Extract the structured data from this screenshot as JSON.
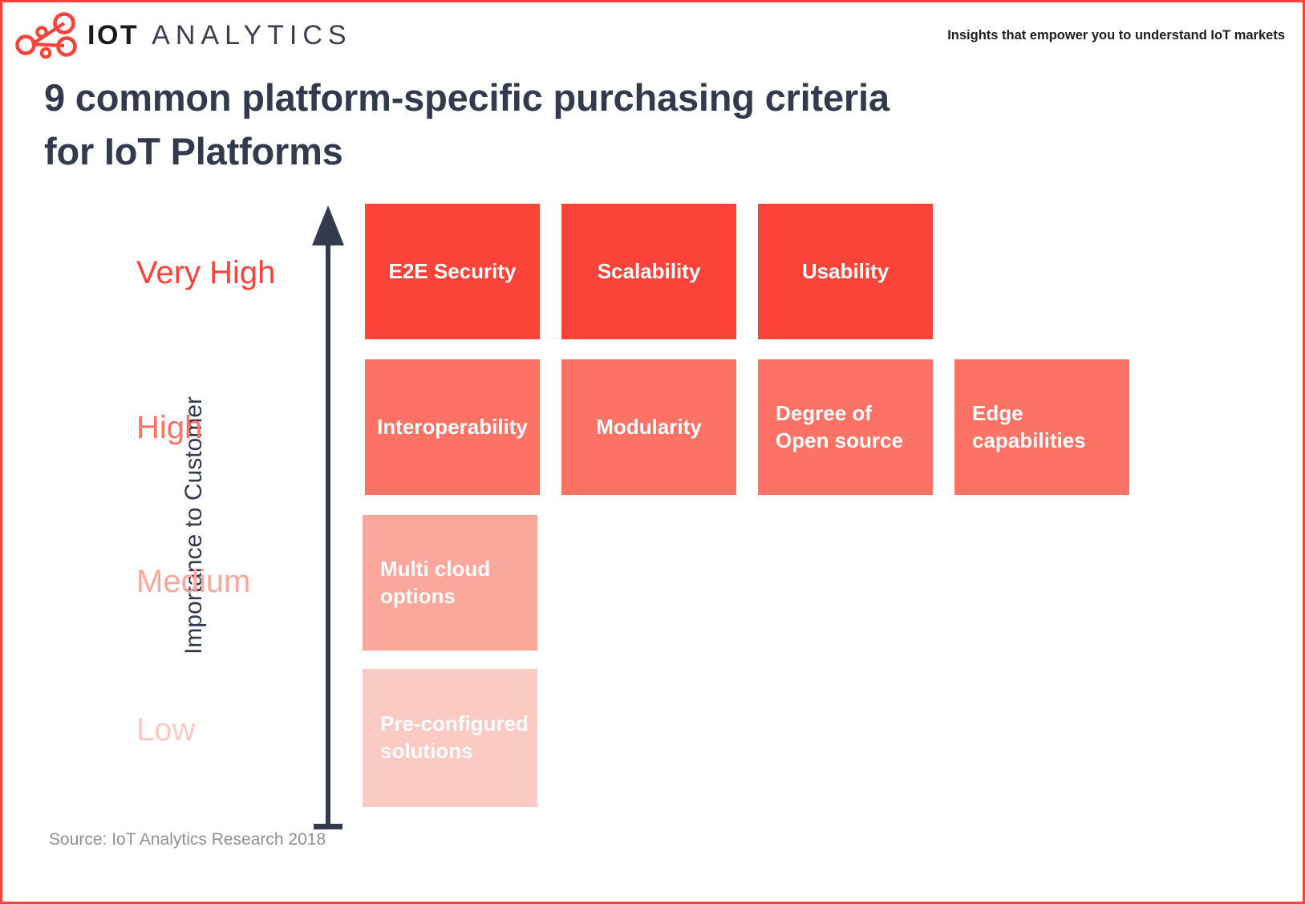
{
  "brand": {
    "logo_icon": "iot-analytics-network-logo",
    "name_bold": "IOT",
    "name_light": "ANALYTICS",
    "tagline": "Insights that empower you to understand IoT markets",
    "accent_color": "#FC4339"
  },
  "title": {
    "line1": "9 common platform-specific purchasing criteria",
    "line2": "for IoT Platforms"
  },
  "source": "Source: IoT Analytics Research 2018",
  "axis": {
    "title": "Importance to Customer",
    "arrow_icon": "up-arrow-icon",
    "ticks": [
      {
        "label": "Very High",
        "color": "#FC4339"
      },
      {
        "label": "High",
        "color": "#FC7264"
      },
      {
        "label": "Medium",
        "color": "#FCA79B"
      },
      {
        "label": "Low",
        "color": "#FBCAC3"
      }
    ]
  },
  "chart_data": {
    "type": "bar",
    "title": "9 common platform-specific purchasing criteria for IoT Platforms",
    "xlabel": "",
    "ylabel": "Importance to Customer",
    "categories": [
      "Very High",
      "High",
      "Medium",
      "Low"
    ],
    "legend_position": "none",
    "grid": false,
    "series": [
      {
        "name": "Very High",
        "level": "Very High",
        "color": "#FC4339",
        "items": [
          {
            "label": "E2E Security",
            "lines": [
              "E2E Security"
            ],
            "align": "center"
          },
          {
            "label": "Scalability",
            "lines": [
              "Scalability"
            ],
            "align": "center"
          },
          {
            "label": "Usability",
            "lines": [
              "Usability"
            ],
            "align": "center"
          }
        ]
      },
      {
        "name": "High",
        "level": "High",
        "color": "#FC7264",
        "items": [
          {
            "label": "Interoperability",
            "lines": [
              "Interoperability"
            ],
            "align": "center"
          },
          {
            "label": "Modularity",
            "lines": [
              "Modularity"
            ],
            "align": "center"
          },
          {
            "label": "Degree of Open source",
            "lines": [
              "Degree of",
              "Open source"
            ],
            "align": "left"
          },
          {
            "label": "Edge capabilities",
            "lines": [
              "Edge",
              "capabilities"
            ],
            "align": "left"
          }
        ]
      },
      {
        "name": "Medium",
        "level": "Medium",
        "color": "#FCA79B",
        "items": [
          {
            "label": "Multi cloud options",
            "lines": [
              "Multi cloud",
              "options"
            ],
            "align": "left"
          }
        ]
      },
      {
        "name": "Low",
        "level": "Low",
        "color": "#FBCAC3",
        "items": [
          {
            "label": "Pre-configured solutions",
            "lines": [
              "Pre-configured",
              "solutions"
            ],
            "align": "left"
          }
        ]
      }
    ],
    "counts": {
      "Very High": 3,
      "High": 4,
      "Medium": 1,
      "Low": 1,
      "total": 9
    }
  }
}
